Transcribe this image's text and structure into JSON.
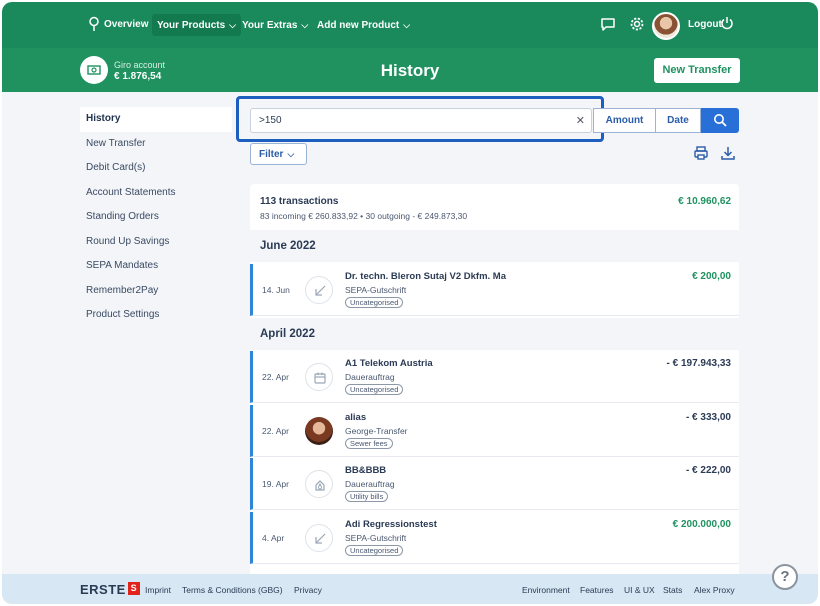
{
  "nav": {
    "overview": "Overview",
    "products": "Your Products",
    "extras": "Your Extras",
    "add_product": "Add new Product",
    "logout": "Logout"
  },
  "account": {
    "name": "Giro account",
    "balance": "€ 1.876,54"
  },
  "page": {
    "title": "History",
    "new_transfer": "New Transfer"
  },
  "sidebar": {
    "items": [
      {
        "label": "History"
      },
      {
        "label": "New Transfer"
      },
      {
        "label": "Debit Card(s)"
      },
      {
        "label": "Account Statements"
      },
      {
        "label": "Standing Orders"
      },
      {
        "label": "Round Up Savings"
      },
      {
        "label": "SEPA Mandates"
      },
      {
        "label": "Remember2Pay"
      },
      {
        "label": "Product Settings"
      }
    ]
  },
  "search": {
    "value": ">150",
    "amount_label": "Amount",
    "date_label": "Date",
    "filter_label": "Filter"
  },
  "summary": {
    "count": "113 transactions",
    "detail": "83 incoming € 260.833,92 • 30 outgoing - € 249.873,30",
    "total": "€ 10.960,62"
  },
  "groups": [
    {
      "month": "June 2022",
      "transactions": [
        {
          "date": "14. Jun",
          "name": "Dr. techn. Bleron Sutaj V2 Dkfm. Ma",
          "type": "SEPA-Gutschrift",
          "tag": "Uncategorised",
          "amount": "€ 200,00",
          "icon": "incoming-arrow-icon"
        }
      ]
    },
    {
      "month": "April 2022",
      "transactions": [
        {
          "date": "22. Apr",
          "name": "A1 Telekom Austria",
          "type": "Dauerauftrag",
          "tag": "Uncategorised",
          "amount": "- € 197.943,33",
          "icon": "calendar-icon"
        },
        {
          "date": "22. Apr",
          "name": "alias",
          "type": "George-Transfer",
          "tag": "Sewer fees",
          "amount": "- € 333,00",
          "icon": "contact-photo"
        },
        {
          "date": "19. Apr",
          "name": "BB&BBB",
          "type": "Dauerauftrag",
          "tag": "Utility bills",
          "amount": "- € 222,00",
          "icon": "utilities-icon"
        },
        {
          "date": "4. Apr",
          "name": "Adi Regressionstest",
          "type": "SEPA-Gutschrift",
          "tag": "Uncategorised",
          "amount": "€ 200.000,00",
          "icon": "incoming-arrow-icon"
        }
      ]
    }
  ],
  "footer": {
    "brand": "ERSTE",
    "brand_mark": "S",
    "imprint": "Imprint",
    "terms": "Terms & Conditions (GBG)",
    "privacy": "Privacy",
    "environment": "Environment",
    "features": "Features",
    "ui_ux": "UI & UX",
    "stats": "Stats",
    "proxy": "Alex Proxy"
  },
  "help": "?",
  "colors": {
    "brand_green": "#1f9260",
    "nav_green": "#1a8a5c",
    "accent_blue": "#2870d8",
    "positive": "#1f9260"
  }
}
